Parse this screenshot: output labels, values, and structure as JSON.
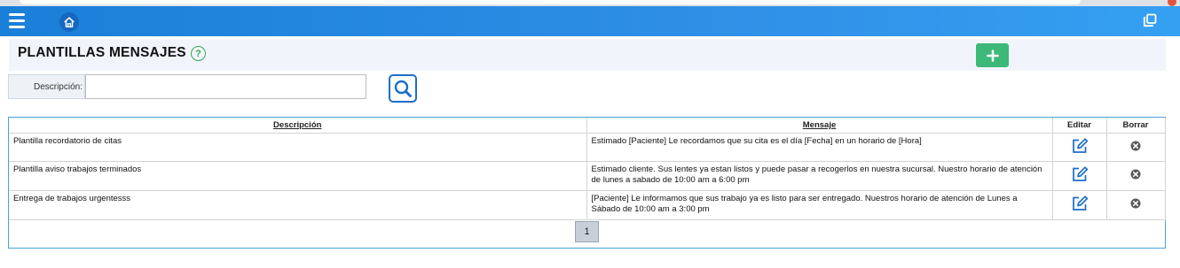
{
  "header": {
    "menu_icon": "hamburger-icon",
    "home_icon": "home-icon",
    "restore_icon": "window-restore-icon",
    "brand_color": "#2f8fe6"
  },
  "page": {
    "title": "PLANTILLAS MENSAJES",
    "help_label": "?",
    "add_icon": "plus-icon",
    "add_color": "#3cb878"
  },
  "filter": {
    "label": "Descripción:",
    "value": "",
    "search_icon": "search-icon"
  },
  "table": {
    "columns": [
      "Descripción",
      "Mensaje",
      "Editar",
      "Borrar"
    ],
    "rows": [
      {
        "descripcion": "Plantilla recordatorio de citas",
        "mensaje": "Estimado [Paciente] Le recordamos que su cita es el día [Fecha] en un horario de [Hora]"
      },
      {
        "descripcion": "Plantilla aviso trabajos terminados",
        "mensaje": "Estimado cliente. Sus lentes ya estan listos y puede pasar a recogerlos en nuestra sucursal. Nuestro horario de atención de lunes a sabado de 10:00 am a 6:00 pm"
      },
      {
        "descripcion": "Entrega de trabajos urgentesss",
        "mensaje": "[Paciente] Le informamos que sus trabajo ya es listo para ser entregado. Nuestros horario de atención de Lunes a Sábado de 10:00 am a 3:00 pm"
      }
    ],
    "edit_icon": "edit-icon",
    "delete_icon": "delete-icon"
  },
  "pagination": {
    "current_page": "1"
  }
}
